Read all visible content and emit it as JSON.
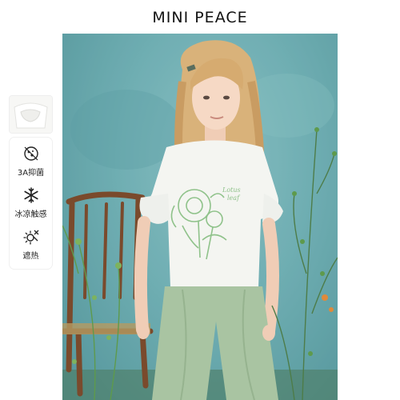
{
  "brand": {
    "name": "MINI PEACE"
  },
  "sidebar": {
    "thumbnail": {
      "icon": "tshirt-sleeve-detail-thumbnail"
    },
    "features": [
      {
        "label": "3A抑菌",
        "icon": "antibacterial-icon"
      },
      {
        "label": "冰凉触感",
        "icon": "snowflake-icon"
      },
      {
        "label": "遮热",
        "icon": "sun-shield-icon"
      }
    ]
  },
  "photo": {
    "tshirt_text_line1": "Lotus",
    "tshirt_text_line2": "leaf"
  },
  "colors": {
    "backdrop": "#6faeb2",
    "tshirt": "#f4f5f1",
    "pants": "#a9c4a2",
    "embroidery": "#8fc28a",
    "hair": "#d9b27a",
    "chair": "#7a4a2c"
  }
}
